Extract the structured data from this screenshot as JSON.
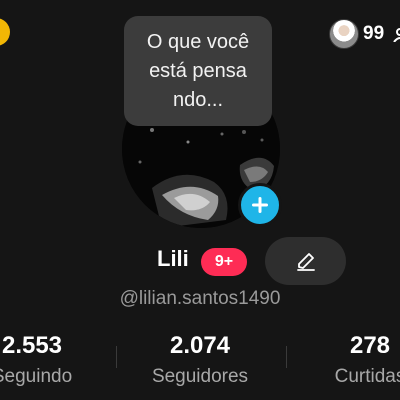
{
  "top_bar": {
    "friend_count": "99",
    "top_right_icon": "add-friend-icon",
    "top_left_icon": "coin-icon"
  },
  "profile": {
    "thought_bubble": {
      "lines": [
        "O que você",
        "está pensa",
        "ndo..."
      ]
    },
    "avatar_icon": "avatar-photo",
    "add_photo_icon": "plus-icon",
    "name": "Lili",
    "notification_badge": "9+",
    "edit_icon": "pencil-icon",
    "handle": "@lilian.santos1490"
  },
  "stats": {
    "following": {
      "value": "2.553",
      "label": "Seguindo"
    },
    "followers": {
      "value": "2.074",
      "label": "Seguidores"
    },
    "likes": {
      "value": "278",
      "label": "Curtidas"
    }
  },
  "colors": {
    "background": "#151515",
    "badge_red": "#fe2c55",
    "add_button_blue": "#1fb5e8",
    "secondary_text": "#9a9a9a"
  }
}
